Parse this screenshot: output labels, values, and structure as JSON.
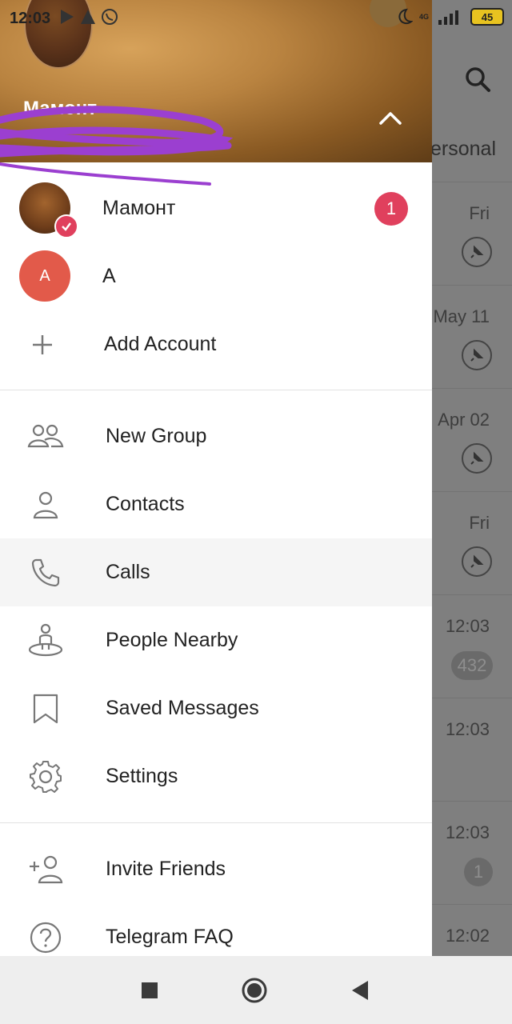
{
  "status_bar": {
    "time": "12:03",
    "network": "4G",
    "battery": "45"
  },
  "background_list": {
    "tab_partial": "ersonal",
    "rows": [
      {
        "date": "Fri",
        "pinned": true,
        "badge": ""
      },
      {
        "date": "May 11",
        "pinned": true,
        "badge": ""
      },
      {
        "date": "Apr 02",
        "pinned": true,
        "badge": ""
      },
      {
        "date": "Fri",
        "pinned": true,
        "badge": ""
      },
      {
        "date": "12:03",
        "pinned": false,
        "badge": "432"
      },
      {
        "date": "12:03",
        "pinned": false,
        "badge": ""
      },
      {
        "date": "12:03",
        "pinned": false,
        "badge": "1"
      },
      {
        "date": "12:02",
        "pinned": false,
        "badge": ""
      }
    ]
  },
  "drawer": {
    "header": {
      "name": "Мамонт"
    },
    "accounts": [
      {
        "name": "Мамонт",
        "unread": "1"
      },
      {
        "name": "A",
        "initial": "A"
      }
    ],
    "add_account": "Add Account",
    "menu": {
      "new_group": "New Group",
      "contacts": "Contacts",
      "calls": "Calls",
      "people_nearby": "People Nearby",
      "saved_messages": "Saved Messages",
      "settings": "Settings",
      "invite_friends": "Invite Friends",
      "faq": "Telegram FAQ"
    }
  },
  "colors": {
    "accent_red": "#e0405d",
    "avatar_a": "#e25a4a",
    "scribble": "#9b3fd0"
  }
}
